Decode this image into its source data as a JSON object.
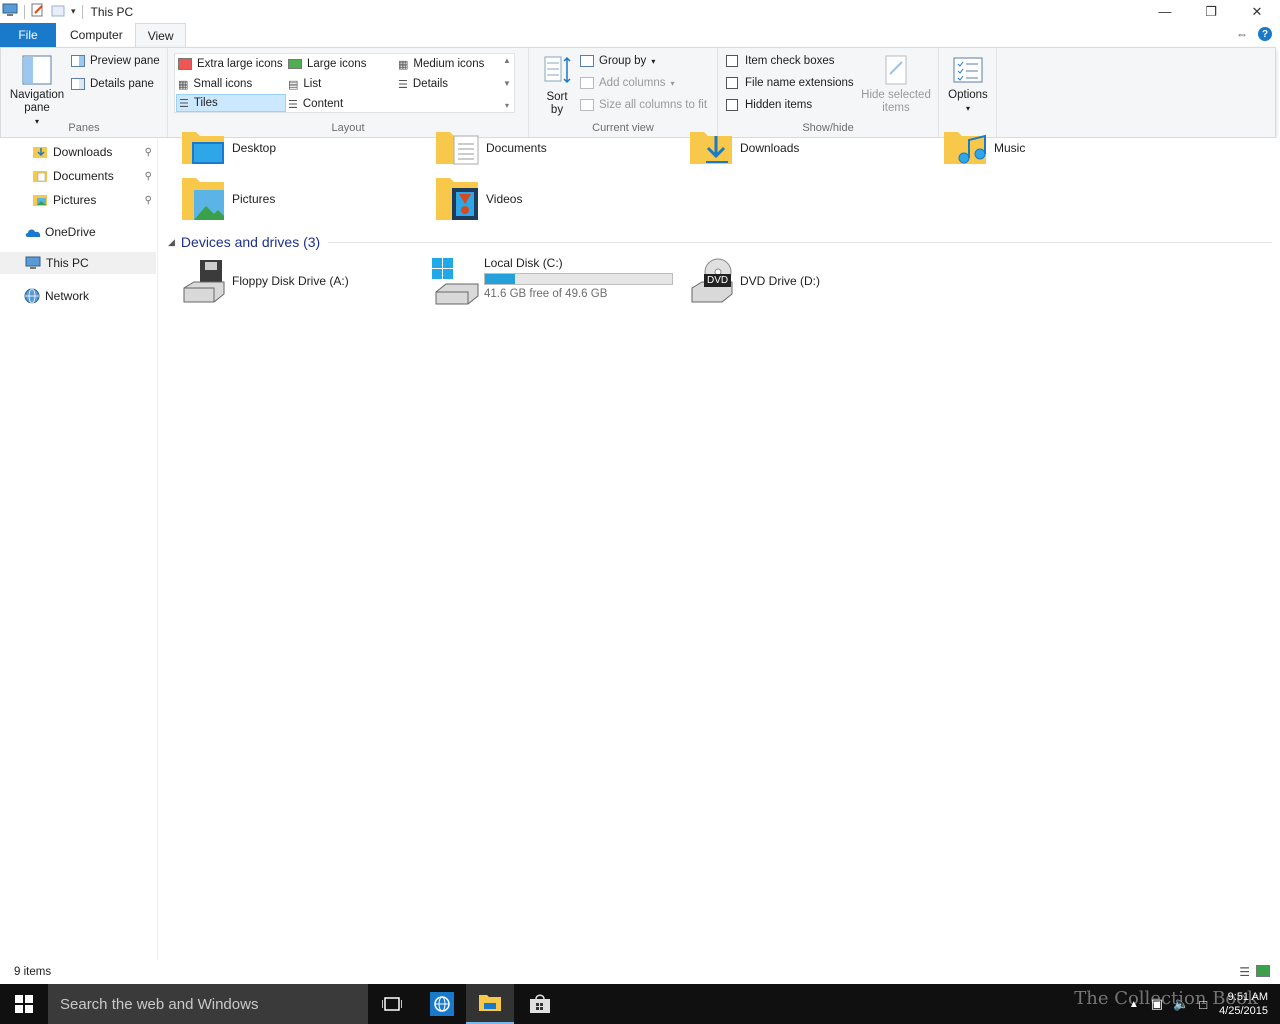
{
  "window": {
    "title": "This PC"
  },
  "ribbon_tabs": {
    "file": "File",
    "computer": "Computer",
    "view": "View"
  },
  "ribbon": {
    "panes": {
      "label": "Panes",
      "navigation_pane": "Navigation pane",
      "preview_pane": "Preview pane",
      "details_pane": "Details pane"
    },
    "layout": {
      "label": "Layout",
      "options": {
        "extra_large_icons": "Extra large icons",
        "large_icons": "Large icons",
        "medium_icons": "Medium icons",
        "small_icons": "Small icons",
        "list": "List",
        "details": "Details",
        "tiles": "Tiles",
        "content": "Content"
      },
      "selected": "Tiles"
    },
    "current_view": {
      "label": "Current view",
      "sort_by": "Sort by",
      "group_by": "Group by",
      "add_columns": "Add columns",
      "size_all_columns": "Size all columns to fit"
    },
    "show_hide": {
      "label": "Show/hide",
      "item_check_boxes": "Item check boxes",
      "file_name_extensions": "File name extensions",
      "hidden_items": "Hidden items",
      "hide_selected_items": "Hide selected items"
    },
    "options": "Options"
  },
  "navpane": {
    "quick_access": [
      {
        "label": "Downloads",
        "pinned": true
      },
      {
        "label": "Documents",
        "pinned": true
      },
      {
        "label": "Pictures",
        "pinned": true
      }
    ],
    "onedrive": "OneDrive",
    "this_pc": "This PC",
    "network": "Network"
  },
  "folders": [
    {
      "name": "Desktop"
    },
    {
      "name": "Documents"
    },
    {
      "name": "Downloads"
    },
    {
      "name": "Music"
    },
    {
      "name": "Pictures"
    },
    {
      "name": "Videos"
    }
  ],
  "devices_section": {
    "header": "Devices and drives (3)"
  },
  "drives": [
    {
      "name": "Floppy Disk Drive (A:)"
    },
    {
      "name": "Local Disk (C:)",
      "free_text": "41.6 GB free of 49.6 GB",
      "used_fraction": 0.16
    },
    {
      "name": "DVD Drive (D:)",
      "badge": "DVD"
    }
  ],
  "status": {
    "item_count": "9 items"
  },
  "taskbar": {
    "search_placeholder": "Search the web and Windows",
    "time": "9:51 AM",
    "date": "4/25/2015",
    "watermark": "The Collection Book"
  },
  "colors": {
    "accent": "#1979ca",
    "folder_yellow": "#f8c84a",
    "drive_bar_fill": "#26a0da",
    "taskbar": "#101010"
  }
}
